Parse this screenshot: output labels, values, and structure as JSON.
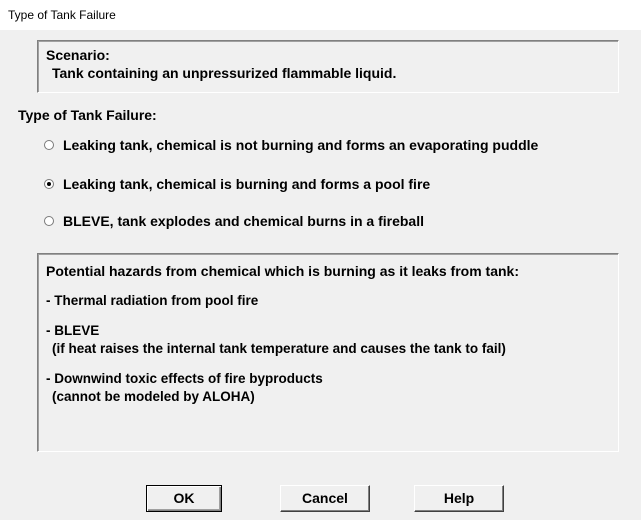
{
  "window": {
    "title": "Type of Tank Failure"
  },
  "scenario": {
    "heading": "Scenario:",
    "text": "Tank containing an unpressurized flammable liquid."
  },
  "failure_type": {
    "label": "Type of Tank Failure:",
    "options": [
      {
        "label": "Leaking tank, chemical is not burning and forms an evaporating puddle",
        "selected": false
      },
      {
        "label": "Leaking tank, chemical is burning and forms a pool fire",
        "selected": true
      },
      {
        "label": "BLEVE, tank explodes and chemical burns in a fireball",
        "selected": false
      }
    ]
  },
  "hazards": {
    "heading": "Potential hazards from chemical which is burning as it leaks from tank:",
    "items": [
      {
        "line1": "- Thermal radiation from pool fire",
        "line2": ""
      },
      {
        "line1": "- BLEVE",
        "line2": "(if heat raises the internal tank temperature and causes the tank to fail)"
      },
      {
        "line1": "- Downwind toxic effects of fire byproducts",
        "line2": "(cannot be modeled by ALOHA)"
      }
    ]
  },
  "buttons": {
    "ok": "OK",
    "cancel": "Cancel",
    "help": "Help"
  }
}
